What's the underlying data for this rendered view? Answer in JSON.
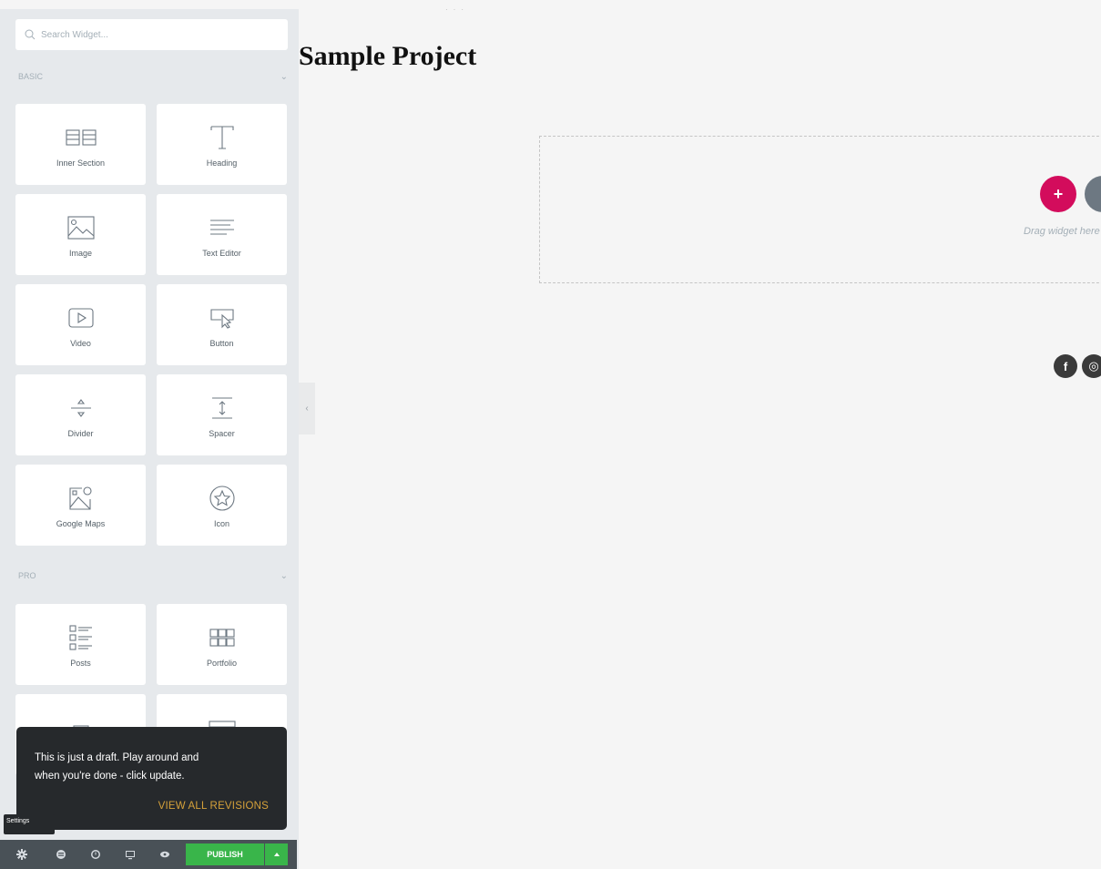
{
  "panel": {
    "search_placeholder": "Search Widget...",
    "categories": [
      {
        "title": "BASIC",
        "widgets": [
          {
            "label": "Inner Section",
            "icon": "inner-section-icon"
          },
          {
            "label": "Heading",
            "icon": "heading-icon"
          },
          {
            "label": "Image",
            "icon": "image-icon"
          },
          {
            "label": "Text Editor",
            "icon": "text-editor-icon"
          },
          {
            "label": "Video",
            "icon": "video-icon"
          },
          {
            "label": "Button",
            "icon": "button-icon"
          },
          {
            "label": "Divider",
            "icon": "divider-icon"
          },
          {
            "label": "Spacer",
            "icon": "spacer-icon"
          },
          {
            "label": "Google Maps",
            "icon": "google-maps-icon"
          },
          {
            "label": "Icon",
            "icon": "star-icon"
          }
        ]
      },
      {
        "title": "PRO",
        "widgets": [
          {
            "label": "Posts",
            "icon": "posts-icon"
          },
          {
            "label": "Portfolio",
            "icon": "portfolio-icon"
          },
          {
            "label": "",
            "icon": "slides-icon"
          },
          {
            "label": "",
            "icon": "form-icon"
          }
        ]
      }
    ]
  },
  "toast": {
    "message": "This is just a draft. Play around and when you're done - click update.",
    "link": "VIEW ALL REVISIONS"
  },
  "tooltip": "Settings",
  "footer": {
    "publish_label": "PUBLISH",
    "buttons": [
      "settings-icon",
      "navigator-icon",
      "history-icon",
      "responsive-icon",
      "preview-icon"
    ]
  },
  "canvas": {
    "page_title": "Sample Project",
    "drag_text": "Drag widget here",
    "social": [
      "f",
      "◎"
    ]
  },
  "colors": {
    "accent": "#d30c5c",
    "publish": "#39b54a",
    "panel_bg": "#e6e9ec",
    "footer_bg": "#495157",
    "toast_link": "#d5a13a"
  }
}
